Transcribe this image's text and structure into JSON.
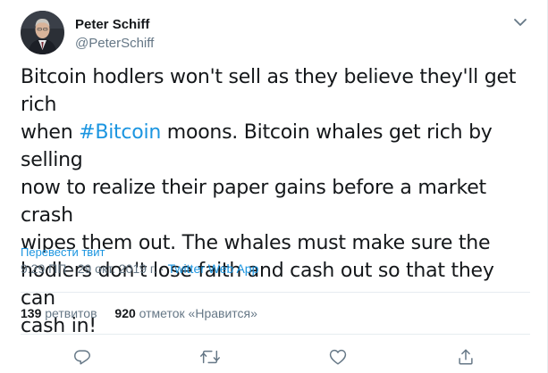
{
  "author": {
    "name": "Peter Schiff",
    "handle": "@PeterSchiff"
  },
  "tweet": {
    "line1": "Bitcoin hodlers won't sell as they believe they'll get rich",
    "line2_pre": "when ",
    "hashtag": "#Bitcoin",
    "line2_post": " moons. Bitcoin whales get rich by selling",
    "line3": "now to realize their paper gains before a market crash",
    "line4": "wipes them out. The whales must make sure the",
    "line5": "hodlers don't lose faith and cash out so that they can",
    "line6": "cash in!"
  },
  "translate_label": "Перевести твит",
  "meta": {
    "time": "9:29 ПП",
    "separator": " · ",
    "date": "29 окт. 2019 г.",
    "app": "Twitter Web App"
  },
  "stats": {
    "retweets_count": "139",
    "retweets_label": "ретвитов",
    "likes_count": "920",
    "likes_label": "отметок «Нравится»"
  },
  "icons": {
    "reply": "reply-icon",
    "retweet": "retweet-icon",
    "like": "heart-icon",
    "share": "share-icon",
    "caret": "chevron-down-icon"
  },
  "colors": {
    "link": "#1b95e0",
    "muted": "#657786",
    "text": "#14171a"
  }
}
